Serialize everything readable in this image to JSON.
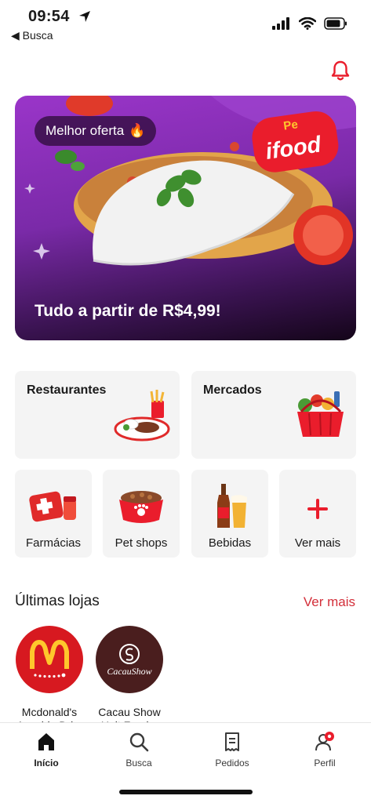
{
  "status_bar": {
    "time": "09:54",
    "back_label": "◀ Busca"
  },
  "banner": {
    "badge": "Melhor oferta",
    "badge_emoji": "🔥",
    "title": "Tudo a partir de R$4,99!",
    "logo_prefix": "Pe",
    "logo_text": "ifood"
  },
  "categories_big": [
    {
      "label": "Restaurantes"
    },
    {
      "label": "Mercados"
    }
  ],
  "categories_small": [
    {
      "label": "Farmácias"
    },
    {
      "label": "Pet shops"
    },
    {
      "label": "Bebidas"
    },
    {
      "label": "Ver mais"
    }
  ],
  "recent_stores": {
    "title": "Últimas lojas",
    "see_more": "Ver mais",
    "stores": [
      {
        "name_line1": "Mcdonald's",
        "name_line2": "Avenida Dri..."
      },
      {
        "name_line1": "Cacau Show",
        "name_line2": "Unit Fund..."
      }
    ],
    "cacau_logo_text": "CacauShow"
  },
  "tabbar": {
    "items": [
      {
        "label": "Início"
      },
      {
        "label": "Busca"
      },
      {
        "label": "Pedidos"
      },
      {
        "label": "Perfil"
      }
    ]
  },
  "colors": {
    "brand_red": "#ea1d2c",
    "mcdonalds_red": "#d71920",
    "mcdonalds_yellow": "#ffc72c",
    "cacau_brown": "#4a1e1e",
    "banner_purple": "#8e34bf"
  }
}
